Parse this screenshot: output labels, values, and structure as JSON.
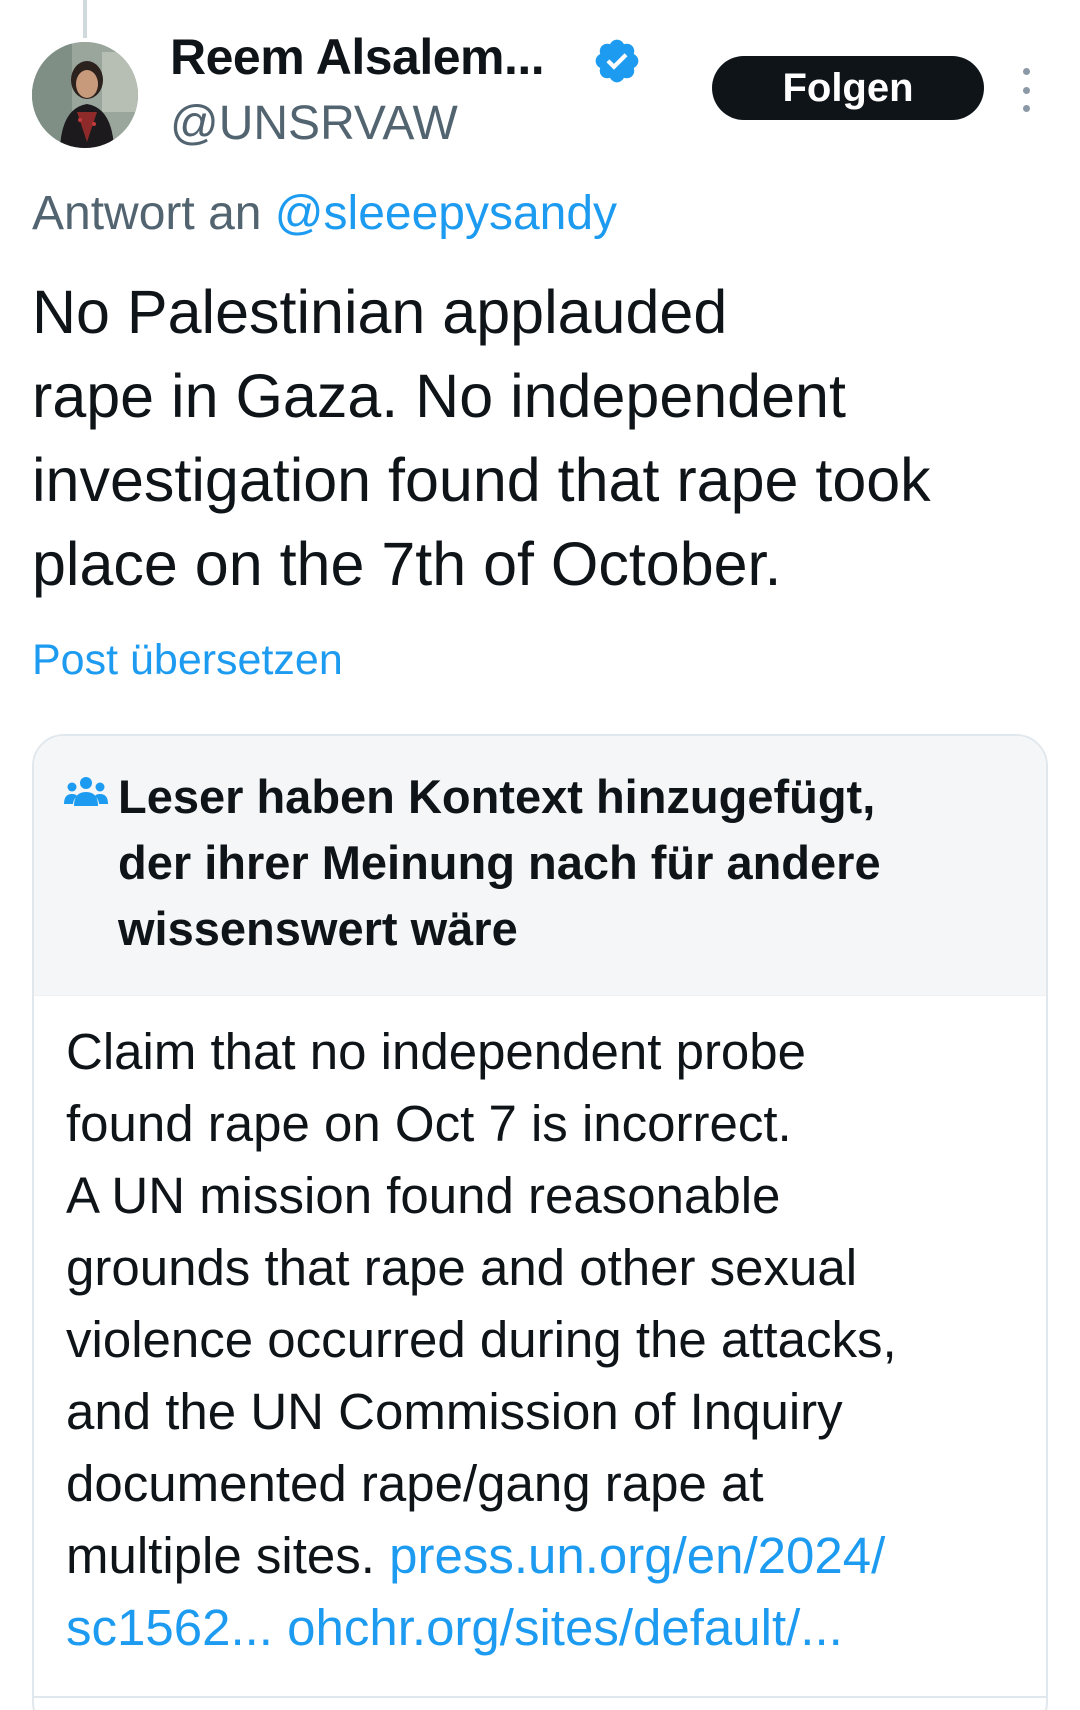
{
  "author": {
    "display_name": "Reem Alsalem...",
    "handle": "@UNSRVAW",
    "verified": true
  },
  "follow_button": {
    "label": "Folgen"
  },
  "more_menu": {
    "icon": "more-vertical-icon"
  },
  "reply_context": {
    "prefix": "Antwort an",
    "mention": "@sleeepysandy"
  },
  "tweet": {
    "lines": [
      "No Palestinian applauded",
      "rape in Gaza. No independent",
      "investigation found that rape took",
      "place on the 7th of October."
    ]
  },
  "translate_link": "Post übersetzen",
  "community_note": {
    "icon": "community-icon",
    "heading_lines": [
      "Leser haben Kontext hinzugefügt,",
      "der ihrer Meinung nach für andere",
      "wissenswert wäre"
    ],
    "body_lines": [
      "Claim that no independent probe",
      "found rape on Oct 7 is incorrect.",
      "A UN mission found reasonable",
      "grounds that rape and other sexual",
      "violence occurred during the attacks,",
      "and the UN Commission of Inquiry",
      "documented rape/gang rape at"
    ],
    "last_line_prefix": "multiple sites. ",
    "link_1_part_1": "press.un.org/en/2024/",
    "link_1_part_2": "sc1562...",
    "link_2": "ohchr.org/sites/default/..."
  },
  "colors": {
    "accent": "#1d9bf0",
    "text_primary": "#0f1419",
    "text_secondary": "#536471",
    "verified_badge": "#1d9bf0",
    "follow_button_bg": "#0f1419"
  }
}
